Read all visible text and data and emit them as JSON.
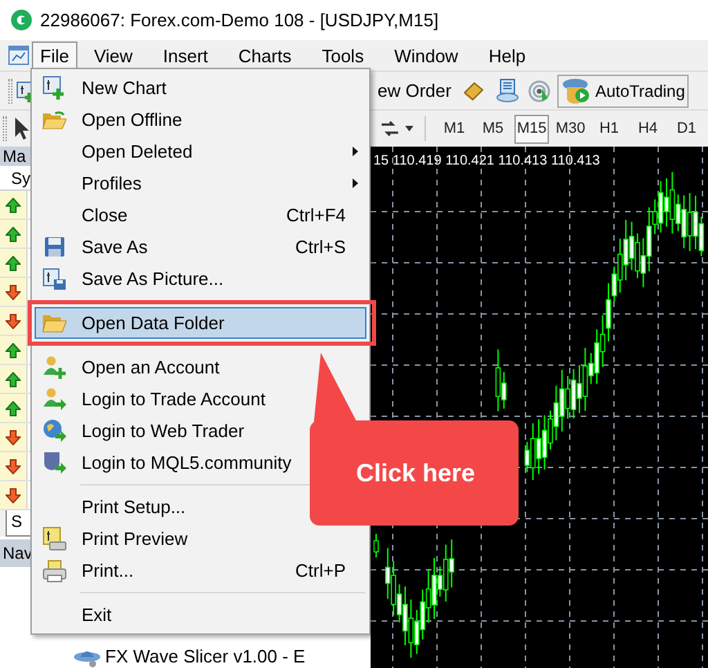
{
  "window": {
    "title": "22986067: Forex.com-Demo 108 - [USDJPY,M15]"
  },
  "menu_bar": [
    {
      "label": "File",
      "selected": true
    },
    {
      "label": "View",
      "selected": false
    },
    {
      "label": "Insert",
      "selected": false
    },
    {
      "label": "Charts",
      "selected": false
    },
    {
      "label": "Tools",
      "selected": false
    },
    {
      "label": "Window",
      "selected": false
    },
    {
      "label": "Help",
      "selected": false
    }
  ],
  "toolbar": {
    "new_order": "ew Order",
    "autotrading": "AutoTrading"
  },
  "timeframes": [
    {
      "label": "M1",
      "selected": false
    },
    {
      "label": "M5",
      "selected": false
    },
    {
      "label": "M15",
      "selected": true
    },
    {
      "label": "M30",
      "selected": false
    },
    {
      "label": "H1",
      "selected": false
    },
    {
      "label": "H4",
      "selected": false
    },
    {
      "label": "D1",
      "selected": false
    }
  ],
  "market_watch": {
    "title": "Ma",
    "column_1": "Sy",
    "tab": "S",
    "rows": [
      {
        "rising": true
      },
      {
        "rising": true
      },
      {
        "rising": true
      },
      {
        "rising": false
      },
      {
        "rising": false
      },
      {
        "rising": true
      },
      {
        "rising": true
      },
      {
        "rising": true
      },
      {
        "rising": false
      },
      {
        "rising": false
      },
      {
        "rising": false
      }
    ]
  },
  "navigator": {
    "title": "Nav",
    "items": [
      "FX Wave Slicer v1.00 - E"
    ]
  },
  "chart": {
    "price_readout": "15 110.419 110.421 110.413 110.413"
  },
  "file_menu": [
    {
      "kind": "item",
      "label": "New Chart",
      "selected": false
    },
    {
      "kind": "item",
      "label": "Open Offline",
      "selected": false
    },
    {
      "kind": "item",
      "label": "Open Deleted",
      "selected": false,
      "submenu": true
    },
    {
      "kind": "item",
      "label": "Profiles",
      "selected": false,
      "submenu": true
    },
    {
      "kind": "item",
      "label": "Close",
      "shortcut": "Ctrl+F4",
      "selected": false
    },
    {
      "kind": "item",
      "label": "Save As",
      "shortcut": "Ctrl+S",
      "selected": false
    },
    {
      "kind": "item",
      "label": "Save As Picture...",
      "selected": false
    },
    {
      "kind": "separator"
    },
    {
      "kind": "item",
      "label": "Open Data Folder",
      "selected": true
    },
    {
      "kind": "separator"
    },
    {
      "kind": "item",
      "label": "Open an Account",
      "selected": false
    },
    {
      "kind": "item",
      "label": "Login to Trade Account",
      "selected": false
    },
    {
      "kind": "item",
      "label": "Login to Web Trader",
      "selected": false
    },
    {
      "kind": "item",
      "label": "Login to MQL5.community",
      "selected": false
    },
    {
      "kind": "separator"
    },
    {
      "kind": "item",
      "label": "Print Setup...",
      "selected": false
    },
    {
      "kind": "item",
      "label": "Print Preview",
      "selected": false
    },
    {
      "kind": "item",
      "label": "Print...",
      "shortcut": "Ctrl+P",
      "selected": false
    },
    {
      "kind": "separator"
    },
    {
      "kind": "item",
      "label": "Exit",
      "selected": false
    }
  ],
  "callout": {
    "text": "Click here"
  }
}
